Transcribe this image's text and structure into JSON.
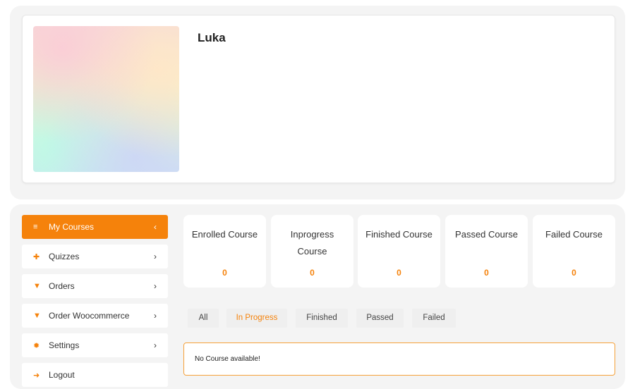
{
  "profile": {
    "name": "Luka"
  },
  "menu": {
    "items": [
      {
        "label": "My Courses",
        "icon": "list-icon",
        "icon_glyph": "≡",
        "chevron": "‹",
        "active": true
      },
      {
        "label": "Quizzes",
        "icon": "puzzle-icon",
        "icon_glyph": "✚",
        "chevron": "›",
        "active": false
      },
      {
        "label": "Orders",
        "icon": "cart-icon",
        "icon_glyph": "▼",
        "chevron": "›",
        "active": false
      },
      {
        "label": "Order Woocommerce",
        "icon": "cart-icon",
        "icon_glyph": "▼",
        "chevron": "›",
        "active": false
      },
      {
        "label": "Settings",
        "icon": "gear-icon",
        "icon_glyph": "✹",
        "chevron": "›",
        "active": false
      },
      {
        "label": "Logout",
        "icon": "logout-icon",
        "icon_glyph": "➜",
        "chevron": "",
        "active": false
      }
    ]
  },
  "stats": [
    {
      "label": "Enrolled Course",
      "value": "0"
    },
    {
      "label": "Inprogress Course",
      "value": "0"
    },
    {
      "label": "Finished Course",
      "value": "0"
    },
    {
      "label": "Passed Course",
      "value": "0"
    },
    {
      "label": "Failed Course",
      "value": "0"
    }
  ],
  "filter_tabs": [
    {
      "label": "All",
      "active": false
    },
    {
      "label": "In Progress",
      "active": true
    },
    {
      "label": "Finished",
      "active": false
    },
    {
      "label": "Passed",
      "active": false
    },
    {
      "label": "Failed",
      "active": false
    }
  ],
  "empty_message": "No Course available!",
  "colors": {
    "accent": "#f5820b",
    "panel_bg": "#f4f4f4",
    "tab_bg": "#efefef"
  }
}
